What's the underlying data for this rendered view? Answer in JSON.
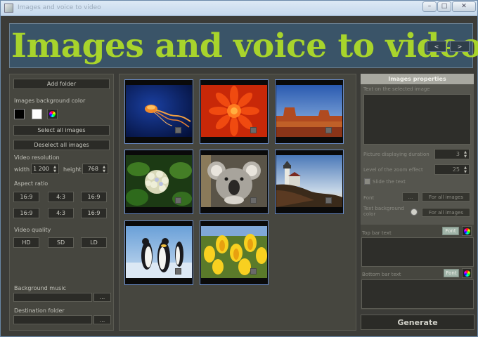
{
  "window": {
    "title": "Images and voice to video"
  },
  "banner": {
    "title": "Images and voice to video",
    "prev_label": "<",
    "next_label": ">"
  },
  "left": {
    "add_folder": "Add folder",
    "bg_color_label": "Images background color",
    "select_all": "Select all images",
    "deselect_all": "Deselect all images",
    "resolution_label": "Video resolution",
    "width_label": "width",
    "width_value": "1 200",
    "height_label": "height",
    "height_value": "768",
    "aspect_label": "Aspect ratio",
    "aspect_options": [
      "16:9",
      "4:3",
      "16:9",
      "16:9",
      "4:3",
      "16:9"
    ],
    "quality_label": "Video quality",
    "quality_options": [
      "HD",
      "SD",
      "LD"
    ],
    "bg_music_label": "Background music",
    "browse_label": "...",
    "dest_label": "Destination folder"
  },
  "gallery": {
    "images": [
      {
        "name": "jellyfish"
      },
      {
        "name": "flower"
      },
      {
        "name": "desert"
      },
      {
        "name": "hydrangea"
      },
      {
        "name": "koala"
      },
      {
        "name": "lighthouse"
      },
      {
        "name": "penguins"
      },
      {
        "name": "tulips"
      }
    ]
  },
  "right": {
    "header": "Images properties",
    "text_label": "Text on the selected image",
    "duration_label": "Picture displaying duration",
    "duration_value": "3",
    "zoom_label": "Level of the zoom effect",
    "zoom_value": "25",
    "slide_text_label": "Slide the text",
    "font_label": "Font",
    "browse_label": "...",
    "for_all_1": "For all images",
    "text_bg_label": "Text background color",
    "for_all_2": "For all images",
    "top_bar_label": "Top bar text",
    "font_btn_1": "Font",
    "bottom_bar_label": "Bottom bar text",
    "font_btn_2": "Font"
  },
  "generate_label": "Generate"
}
